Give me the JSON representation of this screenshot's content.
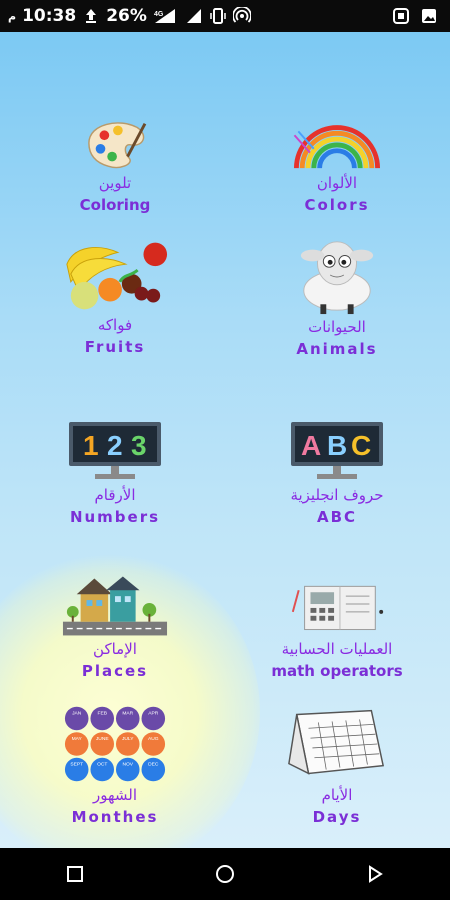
{
  "status_bar": {
    "time": "10:38",
    "am_pm": "م",
    "battery": "26%"
  },
  "tiles": [
    {
      "arabic": "تلوين",
      "english": "Coloring"
    },
    {
      "arabic": "الألوان",
      "english": "Colors"
    },
    {
      "arabic": "فواكه",
      "english": "Fruits"
    },
    {
      "arabic": "الحيوانات",
      "english": "Animals"
    },
    {
      "arabic": "الأرقام",
      "english": "Numbers"
    },
    {
      "arabic": "حروف انجليزية",
      "english": "ABC"
    },
    {
      "arabic": "الإماكن",
      "english": "Places"
    },
    {
      "arabic": "العمليات الحسابية",
      "english": "math operators"
    },
    {
      "arabic": "الشهور",
      "english": "Monthes"
    },
    {
      "arabic": "الأيام",
      "english": "Days"
    }
  ],
  "numbers_icon_text": [
    "1",
    "2",
    "3"
  ],
  "abc_icon_text": [
    "A",
    "B",
    "C"
  ],
  "months_icon_text": [
    "JAN",
    "FEB",
    "MAR",
    "APR",
    "MAY",
    "JUNE",
    "JULY",
    "AUG",
    "SEPT",
    "OCT",
    "NOV",
    "DEC"
  ]
}
